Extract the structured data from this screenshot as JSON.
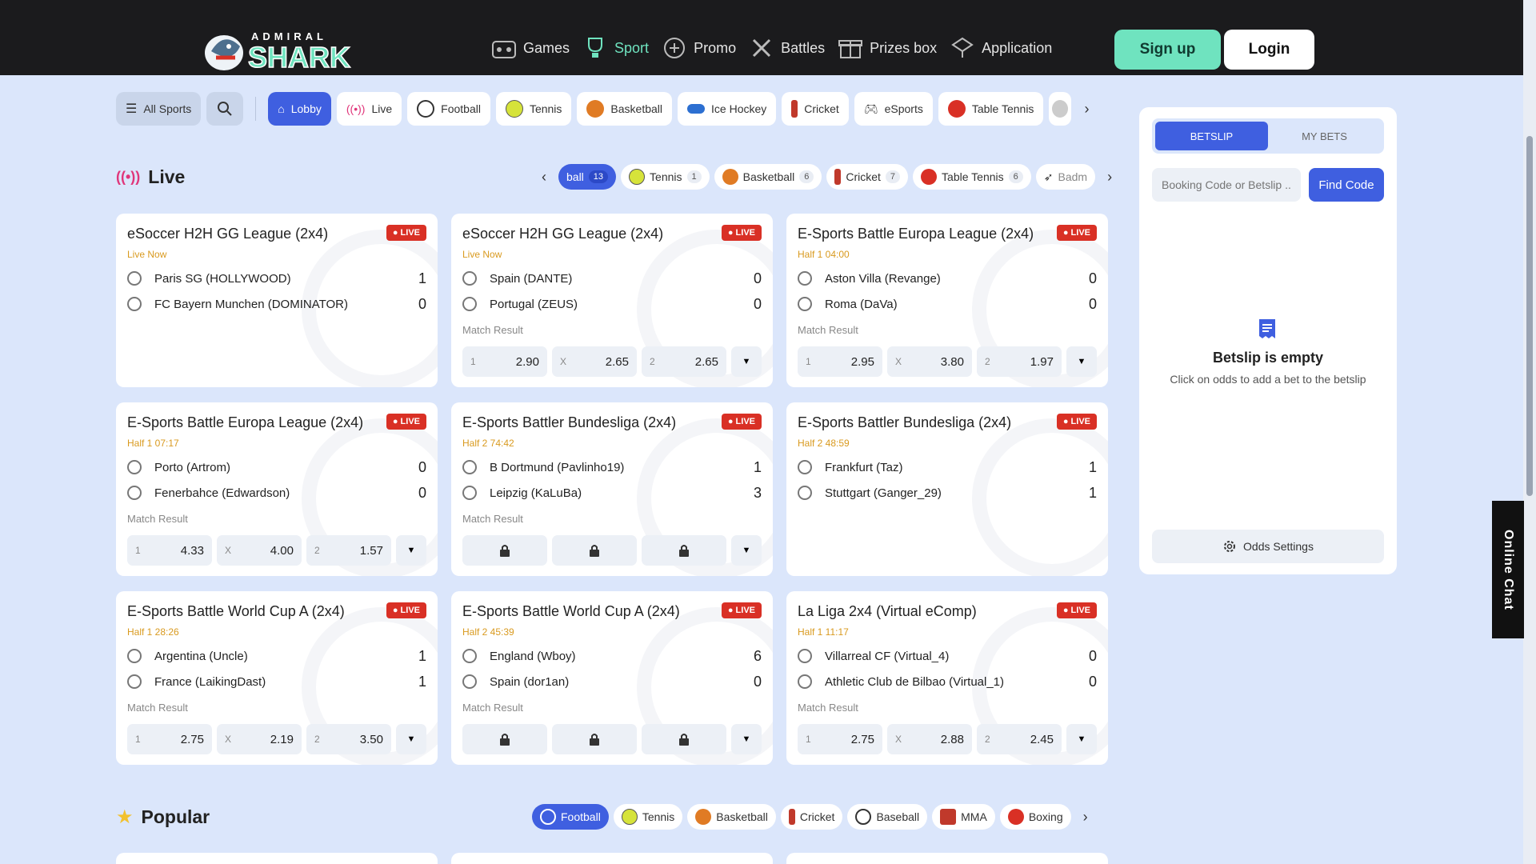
{
  "header": {
    "brand": "ADMIRAL SHARK",
    "nav": [
      {
        "label": "Games",
        "icon": "games-icon"
      },
      {
        "label": "Sport",
        "icon": "trophy-icon",
        "active": true
      },
      {
        "label": "Promo",
        "icon": "promo-icon"
      },
      {
        "label": "Battles",
        "icon": "battles-icon"
      },
      {
        "label": "Prizes box",
        "icon": "prize-box-icon"
      },
      {
        "label": "Application",
        "icon": "application-icon"
      }
    ],
    "signup": "Sign up",
    "login": "Login"
  },
  "filterbar": {
    "all_sports": "All Sports",
    "items": [
      "Lobby",
      "Live",
      "Football",
      "Tennis",
      "Basketball",
      "Ice Hockey",
      "Cricket",
      "eSports",
      "Table Tennis"
    ]
  },
  "live": {
    "title": "Live",
    "chips": [
      {
        "label": "ball",
        "count": "13"
      },
      {
        "label": "Tennis",
        "count": "1"
      },
      {
        "label": "Basketball",
        "count": "6"
      },
      {
        "label": "Cricket",
        "count": "7"
      },
      {
        "label": "Table Tennis",
        "count": "6"
      },
      {
        "label": "Badm",
        "count": ""
      }
    ]
  },
  "events": [
    {
      "league": "eSoccer H2H GG League (2x4)",
      "badge": "LIVE",
      "status": "Live Now",
      "team1": "Paris SG (HOLLYWOOD)",
      "score1": "1",
      "team2": "FC Bayern Munchen (DOMINATOR)",
      "score2": "0",
      "market": "",
      "odds": []
    },
    {
      "league": "eSoccer H2H GG League (2x4)",
      "badge": "LIVE",
      "status": "Live Now",
      "team1": "Spain (DANTE)",
      "score1": "0",
      "team2": "Portugal (ZEUS)",
      "score2": "0",
      "market": "Match Result",
      "odds": [
        {
          "l": "1",
          "v": "2.90"
        },
        {
          "l": "X",
          "v": "2.65"
        },
        {
          "l": "2",
          "v": "2.65"
        }
      ]
    },
    {
      "league": "E-Sports Battle Europa League (2x4)",
      "badge": "LIVE",
      "status": "Half 1 04:00",
      "team1": "Aston Villa (Revange)",
      "score1": "0",
      "team2": "Roma (DaVa)",
      "score2": "0",
      "market": "Match Result",
      "odds": [
        {
          "l": "1",
          "v": "2.95"
        },
        {
          "l": "X",
          "v": "3.80"
        },
        {
          "l": "2",
          "v": "1.97"
        }
      ]
    },
    {
      "league": "E-Sports Battle Europa League (2x4)",
      "badge": "LIVE",
      "status": "Half 1 07:17",
      "team1": "Porto (Artrom)",
      "score1": "0",
      "team2": "Fenerbahce (Edwardson)",
      "score2": "0",
      "market": "Match Result",
      "odds": [
        {
          "l": "1",
          "v": "4.33"
        },
        {
          "l": "X",
          "v": "4.00"
        },
        {
          "l": "2",
          "v": "1.57"
        }
      ]
    },
    {
      "league": "E-Sports Battler Bundesliga (2x4)",
      "badge": "LIVE",
      "status": "Half 2 74:42",
      "team1": "B Dortmund (Pavlinho19)",
      "score1": "1",
      "team2": "Leipzig (KaLuBa)",
      "score2": "3",
      "market": "Match Result",
      "odds": "locked"
    },
    {
      "league": "E-Sports Battler Bundesliga (2x4)",
      "badge": "LIVE",
      "status": "Half 2 48:59",
      "team1": "Frankfurt (Taz)",
      "score1": "1",
      "team2": "Stuttgart (Ganger_29)",
      "score2": "1",
      "market": "",
      "odds": []
    },
    {
      "league": "E-Sports Battle World Cup A (2x4)",
      "badge": "LIVE",
      "status": "Half 1 28:26",
      "team1": "Argentina (Uncle)",
      "score1": "1",
      "team2": "France (LaikingDast)",
      "score2": "1",
      "market": "Match Result",
      "odds": [
        {
          "l": "1",
          "v": "2.75"
        },
        {
          "l": "X",
          "v": "2.19"
        },
        {
          "l": "2",
          "v": "3.50"
        }
      ]
    },
    {
      "league": "E-Sports Battle World Cup A (2x4)",
      "badge": "LIVE",
      "status": "Half 2 45:39",
      "team1": "England (Wboy)",
      "score1": "6",
      "team2": "Spain (dor1an)",
      "score2": "0",
      "market": "Match Result",
      "odds": "locked"
    },
    {
      "league": "La Liga 2x4 (Virtual eComp)",
      "badge": "LIVE",
      "status": "Half 1 11:17",
      "team1": "Villarreal CF (Virtual_4)",
      "score1": "0",
      "team2": "Athletic Club de Bilbao (Virtual_1)",
      "score2": "0",
      "market": "Match Result",
      "odds": [
        {
          "l": "1",
          "v": "2.75"
        },
        {
          "l": "X",
          "v": "2.88"
        },
        {
          "l": "2",
          "v": "2.45"
        }
      ]
    }
  ],
  "popular": {
    "title": "Popular",
    "chips": [
      "Football",
      "Tennis",
      "Basketball",
      "Cricket",
      "Baseball",
      "MMA",
      "Boxing"
    ]
  },
  "betslip": {
    "tab_betslip": "BETSLIP",
    "tab_mybets": "MY BETS",
    "booking_placeholder": "Booking Code or Betslip ...",
    "find_code": "Find Code",
    "empty_title": "Betslip is empty",
    "empty_sub": "Click on odds to add a bet to the betslip",
    "odds_settings": "Odds Settings"
  },
  "chat": "Online Chat",
  "colors": {
    "accent": "#3f5fe0",
    "mint": "#6fe3bf",
    "live": "#d93025",
    "status": "#d99a1f"
  }
}
